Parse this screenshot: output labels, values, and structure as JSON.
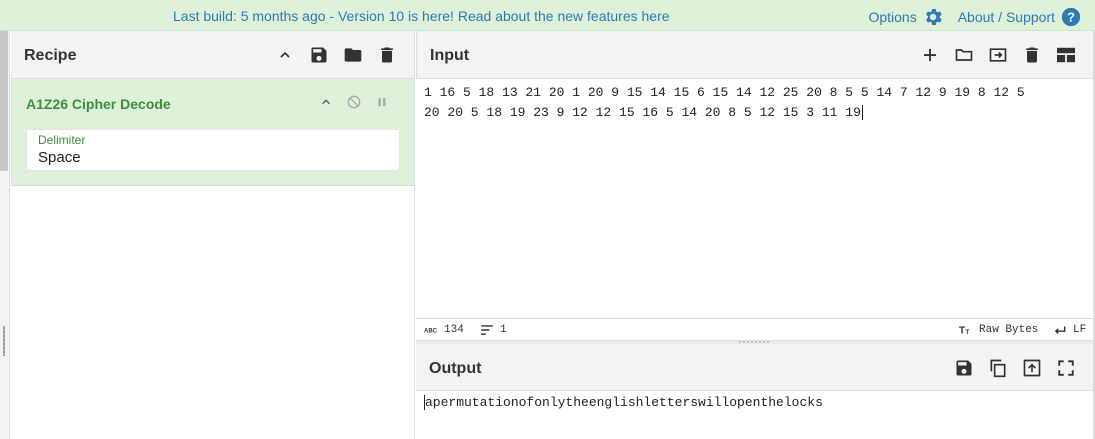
{
  "banner": {
    "build_text": "Last build: 5 months ago - Version 10 is here! Read about the new features here",
    "options_label": "Options",
    "about_label": "About / Support"
  },
  "recipe": {
    "title": "Recipe",
    "operation": {
      "name": "A1Z26 Cipher Decode",
      "delimiter_label": "Delimiter",
      "delimiter_value": "Space"
    }
  },
  "input": {
    "title": "Input",
    "line1": "1 16 5 18 13 21 20 1 20 9 15 14 15 6 15 14 12 25 20 8 5 5 14 7 12 9 19 8 12 5",
    "line2": "20 20 5 18 19 23 9 12 12 15 16 5 14 20 8 5 12 15 3 11 19",
    "char_count": "134",
    "line_count": "1",
    "encoding": "Raw Bytes",
    "eol": "LF"
  },
  "output": {
    "title": "Output",
    "text": "apermutationofonlytheenglishletterswillopenthelocks"
  },
  "colors": {
    "accent": "#2d7bb6",
    "op_green": "#3c8f3c",
    "op_bg": "#dff0d8"
  }
}
